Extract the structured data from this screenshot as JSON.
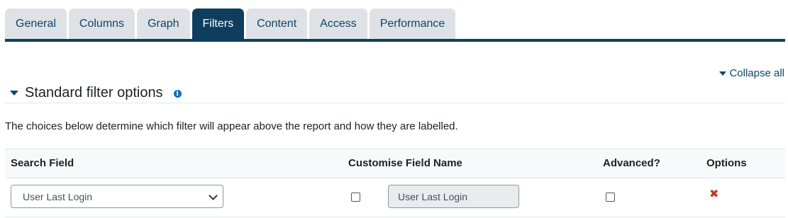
{
  "tabs": [
    {
      "label": "General",
      "active": false
    },
    {
      "label": "Columns",
      "active": false
    },
    {
      "label": "Graph",
      "active": false
    },
    {
      "label": "Filters",
      "active": true
    },
    {
      "label": "Content",
      "active": false
    },
    {
      "label": "Access",
      "active": false
    },
    {
      "label": "Performance",
      "active": false
    }
  ],
  "collapse_all_label": "Collapse all",
  "section": {
    "title": "Standard filter options",
    "info_icon": "info-icon",
    "description": "The choices below determine which filter will appear above the report and how they are labelled."
  },
  "table": {
    "headers": {
      "search_field": "Search Field",
      "customise_field_name": "Customise Field Name",
      "advanced": "Advanced?",
      "options": "Options"
    },
    "rows": [
      {
        "search_field_value": "User Last Login",
        "customise_checked": false,
        "field_name_value": "User Last Login",
        "advanced_checked": false,
        "options_icon": "delete-icon"
      }
    ]
  },
  "colors": {
    "accent": "#0f3d5e",
    "tab_bg": "#dee2e6",
    "link": "#0f4565",
    "delete": "#ca3120"
  }
}
